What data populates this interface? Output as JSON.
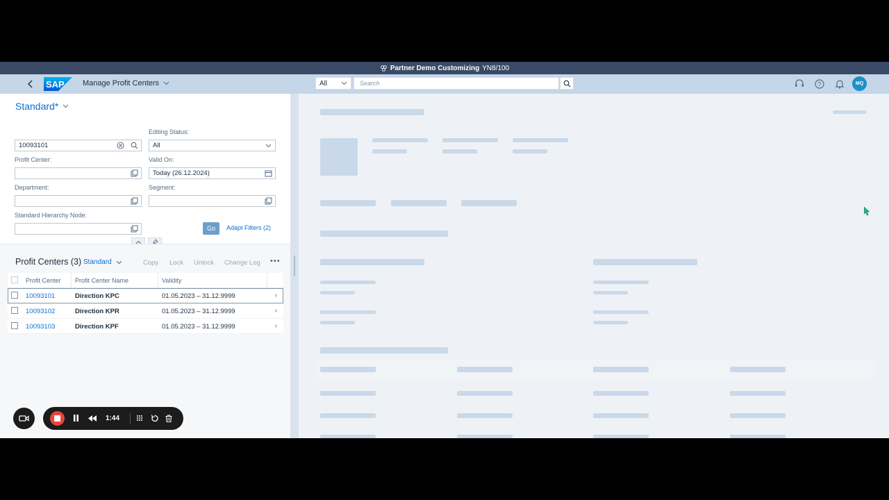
{
  "system_title": "Partner Demo Customizing",
  "system_id": "YN8/100",
  "app_title": "Manage Profit Centers",
  "search": {
    "scope": "All",
    "placeholder": "Search"
  },
  "user_initials": "MQ",
  "filter_bar": {
    "variant": "Standard*",
    "search_value": "10093101",
    "fields": {
      "editing_status": {
        "label": "Editing Status:",
        "value": "All"
      },
      "profit_center": {
        "label": "Profit Center:",
        "value": ""
      },
      "valid_on": {
        "label": "Valid On:",
        "value": "Today (26.12.2024)"
      },
      "department": {
        "label": "Department:",
        "value": ""
      },
      "segment": {
        "label": "Segment:",
        "value": ""
      },
      "hierarchy_node": {
        "label": "Standard Hierarchy Node:",
        "value": ""
      }
    },
    "go_label": "Go",
    "adapt_label": "Adapt Filters (2)"
  },
  "table": {
    "title": "Profit Centers (3)",
    "variant": "Standard",
    "actions": [
      "Copy",
      "Lock",
      "Unlock",
      "Change Log"
    ],
    "columns": [
      "Profit Center",
      "Profit Center Name",
      "Validity"
    ],
    "rows": [
      {
        "id": "10093101",
        "name": "Direction KPC",
        "validity": "01.05.2023 – 31.12.9999"
      },
      {
        "id": "10093102",
        "name": "Direction KPR",
        "validity": "01.05.2023 – 31.12.9999"
      },
      {
        "id": "10093103",
        "name": "Direction KPF",
        "validity": "01.05.2023 – 31.12.9999"
      }
    ]
  },
  "recorder": {
    "elapsed": "1:44"
  },
  "colors": {
    "shell": "#c4d6e8",
    "title_strip": "#3a4a66",
    "link": "#0a6ed1",
    "placeholder": "#c9d9ea",
    "record": "#e8453c"
  }
}
